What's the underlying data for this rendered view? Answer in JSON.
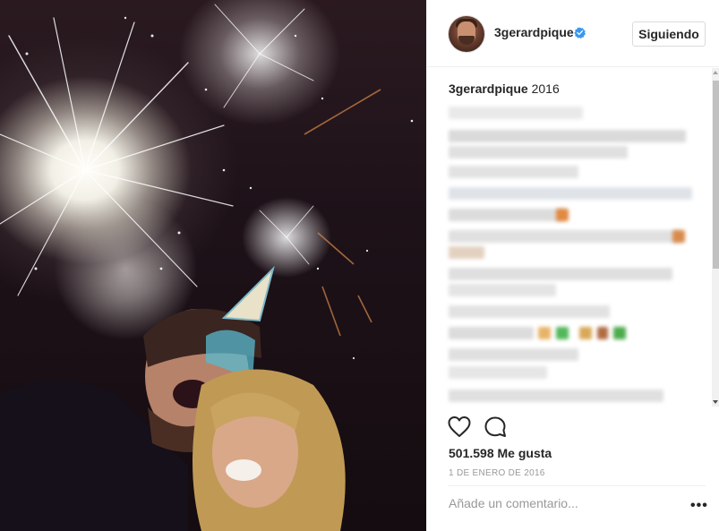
{
  "post": {
    "username": "3gerardpique",
    "verified": true,
    "follow_label": "Siguiendo",
    "caption_text": "2016",
    "likes_text": "501.598 Me gusta",
    "date_text": "1 DE ENERO DE 2016",
    "comment_placeholder": "Añade un comentario...",
    "more_label": "•••"
  },
  "icons": {
    "like": "heart-outline-icon",
    "comment": "speech-bubble-icon",
    "verified": "verified-badge-icon"
  },
  "colors": {
    "verified_blue": "#3897f0",
    "text": "#262626",
    "muted": "#999999",
    "border": "#efefef"
  }
}
